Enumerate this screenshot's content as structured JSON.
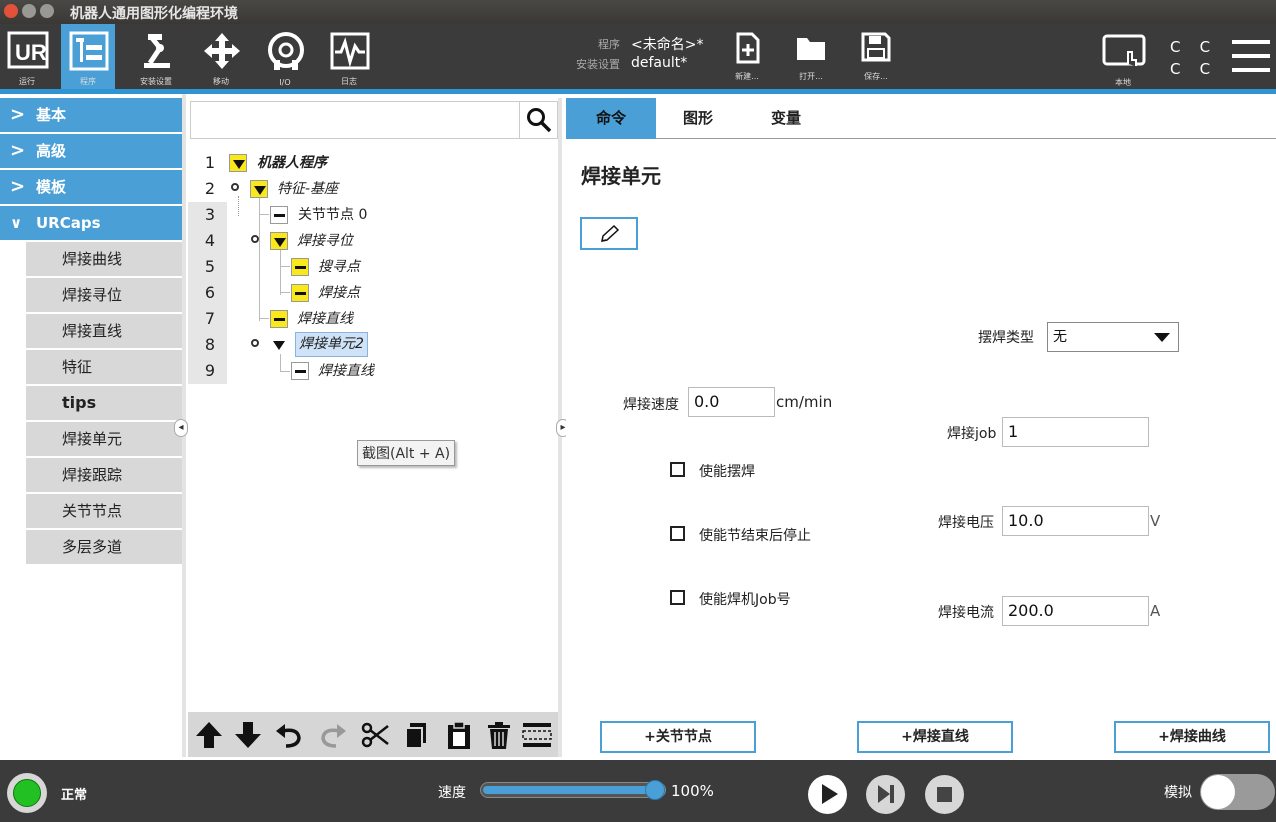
{
  "window": {
    "title": "机器人通用图形化编程环境"
  },
  "nav": [
    {
      "id": "run",
      "label": "运行"
    },
    {
      "id": "program",
      "label": "程序"
    },
    {
      "id": "installation",
      "label": "安装设置"
    },
    {
      "id": "move",
      "label": "移动"
    },
    {
      "id": "io",
      "label": "I/O"
    },
    {
      "id": "log",
      "label": "日志"
    }
  ],
  "program_info": {
    "program_label": "程序",
    "program_value": "<未命名>*",
    "install_label": "安装设置",
    "install_value": "default*"
  },
  "file_buttons": {
    "new": "新建...",
    "open": "打开...",
    "save": "保存..."
  },
  "header_right": {
    "local_label": "本地",
    "cc": [
      "C",
      "C",
      "C",
      "C"
    ]
  },
  "colors": {
    "accent": "#2f94d2",
    "active_nav": "#4a9fd6",
    "highlight": "#f8e81c",
    "status_ok": "#22c022"
  },
  "menu": {
    "categories": [
      {
        "label": "基本",
        "expanded": false
      },
      {
        "label": "高级",
        "expanded": false
      },
      {
        "label": "模板",
        "expanded": false
      },
      {
        "label": "URCaps",
        "expanded": true
      }
    ],
    "urcaps_items": [
      "焊接曲线",
      "焊接寻位",
      "焊接直线",
      "特征",
      "tips",
      "焊接单元",
      "焊接跟踪",
      "关节节点",
      "多层多道"
    ]
  },
  "tree": {
    "search_placeholder": "",
    "rows": [
      {
        "num": "1",
        "label": "机器人程序"
      },
      {
        "num": "2",
        "label": "特征-基座"
      },
      {
        "num": "3",
        "label": "关节节点 0"
      },
      {
        "num": "4",
        "label": "焊接寻位"
      },
      {
        "num": "5",
        "label": "搜寻点"
      },
      {
        "num": "6",
        "label": "焊接点"
      },
      {
        "num": "7",
        "label": "焊接直线"
      },
      {
        "num": "8",
        "label": "焊接单元2"
      },
      {
        "num": "9",
        "label": "焊接直线"
      }
    ],
    "tooltip": "截图(Alt + A)"
  },
  "tabs": [
    "命令",
    "图形",
    "变量"
  ],
  "command": {
    "title": "焊接单元",
    "weave_type_label": "摆焊类型",
    "weave_type_value": "无",
    "speed_label": "焊接速度",
    "speed_value": "0.0",
    "speed_unit": "cm/min",
    "job_label": "焊接job",
    "job_value": "1",
    "voltage_label": "焊接电压",
    "voltage_value": "10.0",
    "voltage_unit": "V",
    "current_label": "焊接电流",
    "current_value": "200.0",
    "current_unit": "A",
    "cb_weave": "使能摆焊",
    "cb_stop": "使能节结束后停止",
    "cb_job": "使能焊机Job号",
    "btn_joint": "+关节节点",
    "btn_line": "+焊接直线",
    "btn_curve": "+焊接曲线"
  },
  "footer": {
    "status": "正常",
    "speed_label": "速度",
    "speed_value": "100%",
    "speed_fraction": 1.0,
    "sim_label": "模拟"
  }
}
